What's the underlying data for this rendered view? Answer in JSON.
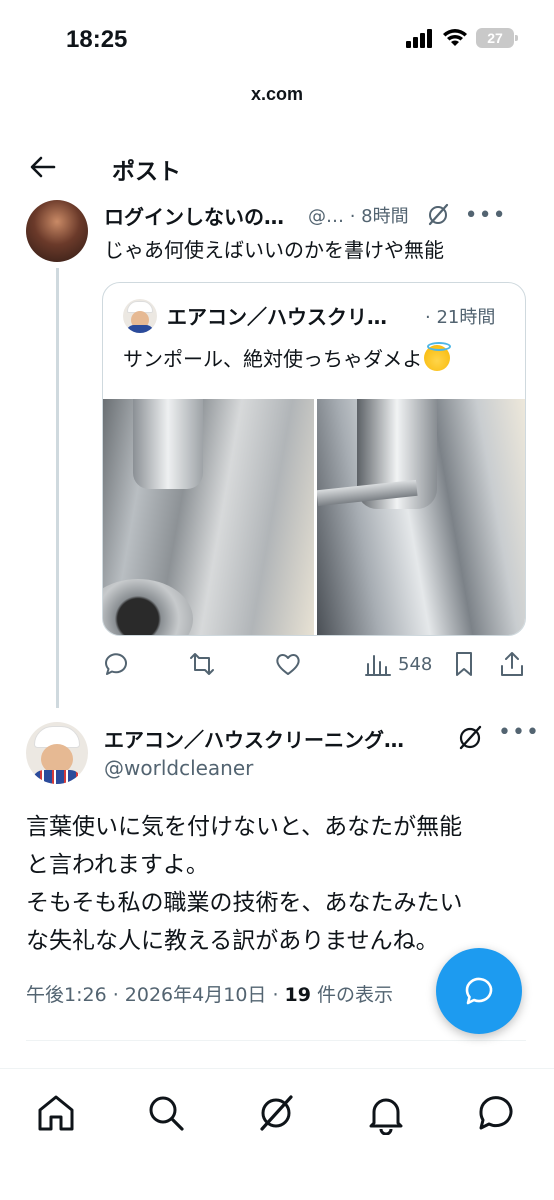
{
  "status_bar": {
    "time": "18:25",
    "battery": "27"
  },
  "browser": {
    "url": "x.com"
  },
  "header": {
    "title": "ポスト"
  },
  "parent_tweet": {
    "name": "ログインしないの…",
    "handle": "@…",
    "time": "· 8時間",
    "text": "じゃあ何使えばいいのかを書けや無能",
    "quote": {
      "name": "エアコン／ハウスクリ…",
      "time": "· 21時間",
      "text": "サンポール、絶対使っちゃダメよ"
    },
    "actions": {
      "views": "548"
    }
  },
  "main_tweet": {
    "name": "エアコン／ハウスクリーニング…",
    "handle": "@worldcleaner",
    "body": [
      "言葉使いに気を付けないと、あなたが無能",
      "と言われますよ。",
      "そもそも私の職業の技術を、あなたみたい",
      "な失礼な人に教える訳がありませんね。"
    ],
    "meta_time": "午後1:26 · 2026年4月10日 · ",
    "meta_count": "19",
    "meta_suffix": " 件の表示"
  },
  "icons": {
    "back": "back-arrow-icon",
    "grok": "grok-icon",
    "reply": "reply-icon",
    "retweet": "retweet-icon",
    "like": "heart-icon",
    "views": "views-icon",
    "bookmark": "bookmark-icon",
    "share": "share-icon",
    "compose": "compose-reply-icon",
    "nav": [
      "home-icon",
      "search-icon",
      "grok-icon",
      "notifications-icon",
      "messages-icon"
    ]
  },
  "colors": {
    "accent": "#1d9bf0",
    "muted": "#536471",
    "text": "#0f1419"
  }
}
